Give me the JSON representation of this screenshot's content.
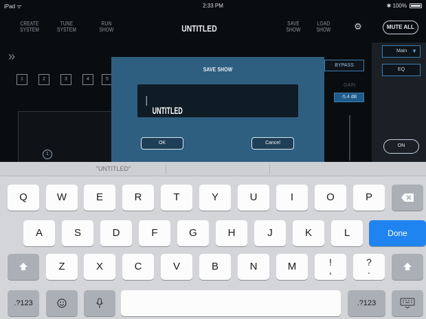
{
  "status_bar": {
    "device": "iPad ᯤ",
    "time": "2:33 PM",
    "battery": "✱ 100%"
  },
  "nav": {
    "items": [
      "CREATE SYSTEM",
      "TUNE SYSTEM",
      "RUN SHOW"
    ],
    "title": "UNTITLED",
    "right_items": [
      "SAVE SHOW",
      "LOAD SHOW"
    ],
    "mute_all": "MUTE ALL",
    "settings_icon": "gear-icon"
  },
  "background": {
    "chevrons": "»",
    "channel_numbers": [
      "1",
      "2",
      "3",
      "4",
      "5"
    ],
    "knob_label": "1",
    "main_select": "Main",
    "eq_label": "EQ",
    "bypass_label": "BYPASS",
    "gain_label": "GAIN",
    "gain_value": "-5.4 dB",
    "on_label": "ON"
  },
  "dialog": {
    "title": "SAVE SHOW",
    "input_value": "UNTITLED",
    "ok_label": "OK",
    "cancel_label": "Cancel"
  },
  "keyboard": {
    "prediction": "\"UNTITLED\"",
    "row1": [
      "Q",
      "W",
      "E",
      "R",
      "T",
      "Y",
      "U",
      "I",
      "O",
      "P"
    ],
    "row2": [
      "A",
      "S",
      "D",
      "F",
      "G",
      "H",
      "J",
      "K",
      "L"
    ],
    "row3": [
      "Z",
      "X",
      "C",
      "V",
      "B",
      "N",
      "M"
    ],
    "punct1": [
      "!",
      ","
    ],
    "punct2": [
      "?",
      "."
    ],
    "done_label": "Done",
    "numbers_label": ".?123",
    "icons": {
      "backspace": "backspace-icon",
      "shift": "shift-icon",
      "emoji": "emoji-icon",
      "mic": "microphone-icon",
      "hide": "keyboard-hide-icon"
    }
  },
  "colors": {
    "accent_blue": "#1f84f0",
    "dialog_bg": "#2f5f80",
    "app_bg": "#0a0d10"
  }
}
